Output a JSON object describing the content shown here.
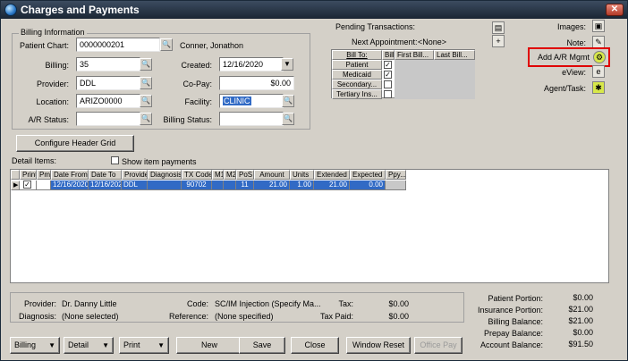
{
  "window": {
    "title": "Charges and Payments",
    "close_glyph": "✕"
  },
  "billing_info": {
    "group_title": "Billing Information",
    "patient_chart_label": "Patient Chart:",
    "patient_chart_value": "0000000201",
    "patient_name": "Conner, Jonathon",
    "billing_label": "Billing:",
    "billing_value": "35",
    "created_label": "Created:",
    "created_value": "12/16/2020",
    "provider_label": "Provider:",
    "provider_value": "DDL",
    "copay_label": "Co-Pay:",
    "copay_value": "$0.00",
    "location_label": "Location:",
    "location_value": "ARIZO0000",
    "facility_label": "Facility:",
    "facility_value": "CLINIC",
    "ar_status_label": "A/R Status:",
    "ar_status_value": "",
    "billing_status_label": "Billing Status:",
    "billing_status_value": ""
  },
  "pending": {
    "title": "Pending Transactions:",
    "next_appt_label": "Next Appointment:",
    "next_appt_value": "<None>",
    "headers": [
      "Bill To:",
      "Bill",
      "First Bill...",
      "Last Bill..."
    ],
    "rows": [
      {
        "label": "Patient",
        "checked": true
      },
      {
        "label": "Medicaid",
        "checked": true
      },
      {
        "label": "Secondary...",
        "checked": false
      },
      {
        "label": "Tertiary Ins...",
        "checked": false
      }
    ]
  },
  "right_panel": {
    "images_label": "Images:",
    "note_label": "Note:",
    "add_ar_label": "Add A/R Mgmt",
    "eview_label": "eView:",
    "agent_task_label": "Agent/Task:",
    "highlight_color": "#e00000"
  },
  "configure_btn": "Configure Header Grid",
  "detail_label": "Detail Items:",
  "show_item_payments": "Show item payments",
  "grid": {
    "headers": [
      "Print",
      "Pmt",
      "Date From",
      "Date To",
      "Provider",
      "Diagnosis",
      "TX Code",
      "M1",
      "M2",
      "PoS",
      "Amount",
      "Units",
      "Extended",
      "Expected",
      "Ppy..."
    ],
    "row": [
      "12/16/2020",
      "12/16/2020",
      "DDL",
      "",
      "90702",
      "",
      "",
      "11",
      "21.00",
      "1.00",
      "21.00",
      "0.00",
      ""
    ],
    "select_color": "#316ac5"
  },
  "footer_info": {
    "provider_label": "Provider:",
    "provider_value": "Dr. Danny Little",
    "diagnosis_label": "Diagnosis:",
    "diagnosis_value": "(None selected)",
    "code_label": "Code:",
    "code_value": "SC/IM Injection (Specify Ma...",
    "reference_label": "Reference:",
    "reference_value": "(None specified)",
    "tax_label": "Tax:",
    "tax_value": "$0.00",
    "tax_paid_label": "Tax Paid:",
    "tax_paid_value": "$0.00"
  },
  "balances": [
    {
      "label": "Patient Portion:",
      "value": "$0.00"
    },
    {
      "label": "Insurance Portion:",
      "value": "$21.00"
    },
    {
      "label": "Billing Balance:",
      "value": "$21.00"
    },
    {
      "label": "Prepay Balance:",
      "value": "$0.00"
    },
    {
      "label": "Account Balance:",
      "value": "$91.50"
    }
  ],
  "buttons": {
    "billing": "Billing",
    "detail": "Detail",
    "print": "Print",
    "new": "New",
    "save": "Save",
    "close": "Close",
    "window_reset": "Window Reset",
    "office_pay": "Office Pay"
  }
}
